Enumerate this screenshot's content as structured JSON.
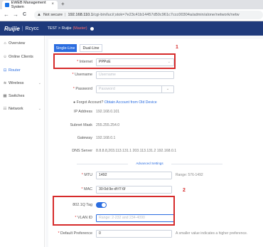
{
  "browser": {
    "tab_title": "EWEB Management System",
    "tab_close": "×",
    "new_tab": "+",
    "back": "←",
    "forward": "→",
    "reload": "C",
    "not_secure": "Not secure",
    "url_host": "192.168.110.1",
    "url_path": "/cgi-bin/luci/;stok=7e23c41b14457d50c961c7ccc00304a/admin/alone/network/netw"
  },
  "header": {
    "logo": "Ruijie",
    "separator": "|",
    "brand": "Rcycc",
    "breadcrumb_prefix": "TEST >",
    "breadcrumb_device": "Ruijie",
    "breadcrumb_tag": "(Master)"
  },
  "sidebar": {
    "items": [
      {
        "label": "Overview",
        "icon": "⌂"
      },
      {
        "label": "Online Clients",
        "icon": "☺"
      },
      {
        "label": "Router",
        "icon": "⊡"
      },
      {
        "label": "Wireless",
        "icon": "≋"
      },
      {
        "label": "Switches",
        "icon": "▦"
      },
      {
        "label": "Network",
        "icon": "☷"
      }
    ],
    "chevron": "⌄"
  },
  "tabs": {
    "single": "Single-Line",
    "dual": "Dual-Line"
  },
  "form": {
    "internet_label": "Internet",
    "internet_value": "PPPoE",
    "username_label": "Username",
    "username_placeholder": "Username",
    "password_label": "Password",
    "password_placeholder": "Password",
    "forgot_text": "Forgot Account?",
    "forgot_link": "Obtain Account from Old Device",
    "ip_label": "IP Address",
    "ip_value": "192.168.0.101",
    "subnet_label": "Subnet Mask",
    "subnet_value": "255.255.254.0",
    "gateway_label": "Gateway",
    "gateway_value": "192.168.0.1",
    "dns_label": "DNS Server",
    "dns_value": "8.8.8.8,203.113.131.1 203.113.131.2 192.168.0.1",
    "advanced": "Advanced Settings",
    "mtu_label": "MTU",
    "mtu_value": "1492",
    "mtu_hint": "Range: 576-1492",
    "mac_label": "MAC",
    "mac_value": "30:0d:9e:df:f7:6f",
    "vlan_tag_label": "802.1Q Tag",
    "vlan_id_label": "VLAN ID",
    "vlan_id_placeholder": "Range: 2-232 and 234-4090",
    "pref_label": "Default Preference",
    "pref_value": "0",
    "pref_hint": "A smaller value indicates a higher preference."
  },
  "annotations": {
    "marker1": "1",
    "marker2": "2",
    "color": "#d62b2b"
  },
  "colors": {
    "accent": "#2b6de0",
    "header_bg": "#1f3a7b"
  },
  "icons": {
    "warning": "▲",
    "caret": "⌄",
    "eye": "⌄",
    "required": "*",
    "info": "●"
  }
}
